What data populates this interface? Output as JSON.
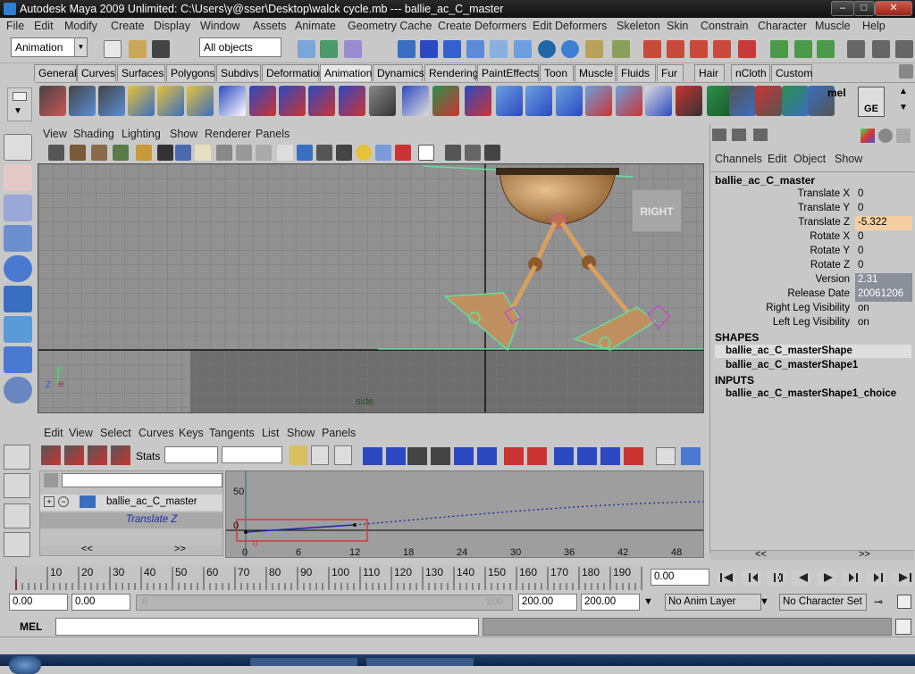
{
  "titlebar": {
    "title": "Autodesk Maya 2009 Unlimited: C:\\Users\\y@sser\\Desktop\\walck cycle.mb   ---   ballie_ac_C_master",
    "minimize": "–",
    "maximize": "□",
    "close": "✕"
  },
  "menu": [
    "File",
    "Edit",
    "Modify",
    "Create",
    "Display",
    "Window",
    "Assets",
    "Animate",
    "Geometry Cache",
    "Create Deformers",
    "Edit Deformers",
    "Skeleton",
    "Skin",
    "Constrain",
    "Character",
    "Muscle",
    "Help"
  ],
  "status": {
    "menuset": "Animation",
    "selection_mode": "All objects"
  },
  "shelf_tabs": [
    "General",
    "Curves",
    "Surfaces",
    "Polygons",
    "Subdivs",
    "Deformation",
    "Animation",
    "Dynamics",
    "Rendering",
    "PaintEffects",
    "Toon",
    "Muscle",
    "Fluids",
    "Fur",
    "Hair",
    "nCloth",
    "Custom"
  ],
  "shelf_active": "Animation",
  "shelf_right_label": "mel",
  "shelf_ge_label": "GE",
  "viewport": {
    "menu": [
      "View",
      "Shading",
      "Lighting",
      "Show",
      "Renderer",
      "Panels"
    ],
    "camera_label": "side",
    "viewcube_label": "RIGHT",
    "axis_z": "Z",
    "axis_x": "X",
    "axis_y": "Y"
  },
  "channelbox": {
    "menu": [
      "Channels",
      "Edit",
      "Object",
      "Show"
    ],
    "object": "ballie_ac_C_master",
    "channels": [
      {
        "name": "Translate X",
        "value": "0",
        "style": "normal"
      },
      {
        "name": "Translate Y",
        "value": "0",
        "style": "normal"
      },
      {
        "name": "Translate Z",
        "value": "-5.322",
        "style": "keyed"
      },
      {
        "name": "Rotate X",
        "value": "0",
        "style": "normal"
      },
      {
        "name": "Rotate Y",
        "value": "0",
        "style": "normal"
      },
      {
        "name": "Rotate Z",
        "value": "0",
        "style": "normal"
      },
      {
        "name": "Version",
        "value": "2.31",
        "style": "locked"
      },
      {
        "name": "Release Date",
        "value": "20061206",
        "style": "locked"
      },
      {
        "name": "Right Leg Visibility",
        "value": "on",
        "style": "normal"
      },
      {
        "name": "Left Leg Visibility",
        "value": "on",
        "style": "normal"
      }
    ],
    "shapes_header": "SHAPES",
    "shapes": [
      "ballie_ac_C_masterShape",
      "ballie_ac_C_masterShape1"
    ],
    "inputs_header": "INPUTS",
    "inputs": [
      "ballie_ac_C_masterShape1_choice"
    ],
    "scroll_left": "<<",
    "scroll_right": ">>"
  },
  "graph": {
    "menu": [
      "Edit",
      "View",
      "Select",
      "Curves",
      "Keys",
      "Tangents",
      "List",
      "Show",
      "Panels"
    ],
    "stats_label": "Stats",
    "outliner_item": "ballie_ac_C_master",
    "outliner_attr": "Translate Z",
    "y_labels": [
      "50",
      "0"
    ],
    "x_labels": [
      "0",
      "6",
      "12",
      "18",
      "24",
      "30",
      "36",
      "42",
      "48"
    ],
    "key_label": "0",
    "scroll_left": "<<",
    "scroll_right": ">>"
  },
  "timeline": {
    "ticks": [
      "10",
      "20",
      "30",
      "40",
      "50",
      "60",
      "70",
      "80",
      "90",
      "100",
      "110",
      "120",
      "130",
      "140",
      "150",
      "160",
      "170",
      "180",
      "190",
      "2"
    ],
    "current_frame": "0.00"
  },
  "range": {
    "start": "0.00",
    "playback_start": "0.00",
    "slider_start": "0",
    "slider_end": "200",
    "playback_end": "200.00",
    "end": "200.00",
    "anim_layer": "No Anim Layer",
    "character_set": "No Character Set"
  },
  "mel": {
    "label": "MEL"
  },
  "colors": {
    "keyed": "#f5cfa3",
    "locked": "#8a8f9a",
    "curve": "#1a2ea8",
    "highlight": "#5fe0a0"
  }
}
